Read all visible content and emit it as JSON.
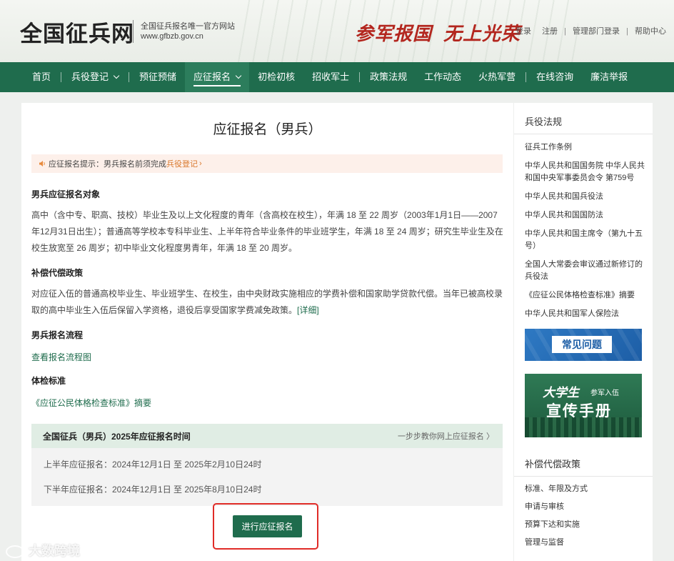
{
  "header": {
    "logo": "全国征兵网",
    "subtitle": "全国征兵报名唯一官方网站",
    "domain": "www.gfbzb.gov.cn",
    "slogan_1": "参军报国",
    "slogan_2": "无上光荣",
    "links": [
      "登录",
      "注册",
      "管理部门登录",
      "帮助中心"
    ]
  },
  "nav": {
    "items": [
      {
        "label": "首页"
      },
      {
        "label": "兵役登记"
      },
      {
        "label": "预征预储"
      },
      {
        "label": "应征报名"
      },
      {
        "label": "初检初核"
      },
      {
        "label": "招收军士"
      },
      {
        "label": "政策法规"
      },
      {
        "label": "工作动态"
      },
      {
        "label": "火热军营"
      },
      {
        "label": "在线咨询"
      },
      {
        "label": "廉洁举报"
      }
    ],
    "active": "应征报名"
  },
  "main": {
    "title": "应征报名（男兵）",
    "notice": {
      "text": "应征报名提示：男兵报名前须完成",
      "link": "兵役登记"
    },
    "sections": [
      {
        "heading": "男兵应征报名对象",
        "text": "高中（含中专、职高、技校）毕业生及以上文化程度的青年（含高校在校生），年满 18 至 22 周岁（2003年1月1日——2007年12月31日出生）；普通高等学校本专科毕业生、上半年符合毕业条件的毕业班学生，年满 18 至 24 周岁；研究生毕业生及在校生放宽至 26 周岁；初中毕业文化程度男青年，年满 18 至 20 周岁。"
      },
      {
        "heading": "补偿代偿政策",
        "text": "对应征入伍的普通高校毕业生、毕业班学生、在校生，由中央财政实施相应的学费补偿和国家助学贷款代偿。当年已被高校录取的高中毕业生入伍后保留入学资格，退役后享受国家学费减免政策。",
        "link": "[详细]"
      },
      {
        "heading": "男兵报名流程",
        "link": "查看报名流程图"
      },
      {
        "heading": "体检标准",
        "link": "《应征公民体格检查标准》摘要"
      }
    ],
    "time_box": {
      "title": "全国征兵（男兵）2025年应征报名时间",
      "guide": "一步步教你网上应征报名 〉",
      "rows": [
        "上半年应征报名：2024年12月1日 至 2025年2月10日24时",
        "下半年应征报名：2024年12月1日 至 2025年8月10日24时"
      ]
    },
    "apply_button": "进行应征报名"
  },
  "sidebar": {
    "laws_heading": "兵役法规",
    "laws": [
      "征兵工作条例",
      "中华人民共和国国务院 中华人民共和国中央军事委员会令 第759号",
      "中华人民共和国兵役法",
      "中华人民共和国国防法",
      "中华人民共和国主席令（第九十五号）",
      "全国人大常委会审议通过新修订的兵役法",
      "《应征公民体格检查标准》摘要",
      "中华人民共和国军人保险法"
    ],
    "faq_banner": "常见问题",
    "handbook_banner_1": "大学生",
    "handbook_banner_1s": "参军入伍",
    "handbook_banner_2": "宣传手册",
    "policy_heading": "补偿代偿政策",
    "policy": [
      "标准、年限及方式",
      "申请与审核",
      "预算下达和实施",
      "管理与监督"
    ]
  },
  "watermark": "大数跨境",
  "colors": {
    "brand_green": "#1f6c4d",
    "slogan_red": "#b3261e",
    "notice_orange": "#d9772b",
    "highlight_red": "#e02b27"
  }
}
